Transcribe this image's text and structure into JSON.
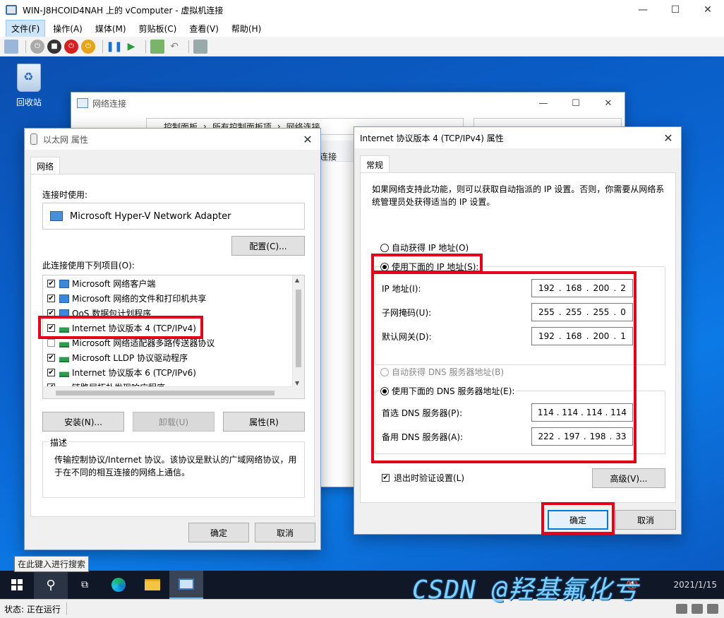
{
  "host": {
    "title": "WIN-J8HCOID4NAH 上的 vComputer - 虚拟机连接",
    "menu": [
      "文件(F)",
      "操作(A)",
      "媒体(M)",
      "剪贴板(C)",
      "查看(V)",
      "帮助(H)"
    ],
    "status": "状态: 正在运行"
  },
  "desktop": {
    "recycle_bin": "回收站"
  },
  "network_window": {
    "title": "网络连接",
    "breadcrumb": [
      "控制面板",
      "所有控制面板项",
      "网络连接"
    ],
    "partial_text": "连接"
  },
  "ethernet_dialog": {
    "title": "以太网 属性",
    "tab": "网络",
    "connect_using_label": "连接时使用:",
    "adapter": "Microsoft Hyper-V Network Adapter",
    "configure_button": "配置(C)...",
    "items_label": "此连接使用下列项目(O):",
    "items": [
      {
        "label": "Microsoft 网络客户端",
        "checked": true,
        "icon": "network-icon"
      },
      {
        "label": "Microsoft 网络的文件和打印机共享",
        "checked": true,
        "icon": "network-icon"
      },
      {
        "label": "QoS 数据包计划程序",
        "checked": true,
        "icon": "network-icon"
      },
      {
        "label": "Internet 协议版本 4 (TCP/IPv4)",
        "checked": true,
        "icon": "protocol-icon"
      },
      {
        "label": "Microsoft 网络适配器多路传送器协议",
        "checked": false,
        "icon": "protocol-icon"
      },
      {
        "label": "Microsoft LLDP 协议驱动程序",
        "checked": true,
        "icon": "protocol-icon"
      },
      {
        "label": "Internet 协议版本 6 (TCP/IPv6)",
        "checked": true,
        "icon": "protocol-icon"
      },
      {
        "label": "链路层拓扑发现响应程序",
        "checked": true,
        "icon": "protocol-icon"
      }
    ],
    "install_button": "安装(N)...",
    "uninstall_button": "卸载(U)",
    "properties_button": "属性(R)",
    "description_legend": "描述",
    "description_text": "传输控制协议/Internet 协议。该协议是默认的广域网络协议，用于在不同的相互连接的网络上通信。",
    "ok_button": "确定",
    "cancel_button": "取消"
  },
  "ipv4_dialog": {
    "title": "Internet 协议版本 4 (TCP/IPv4) 属性",
    "tab": "常规",
    "intro": "如果网络支持此功能，则可以获取自动指派的 IP 设置。否则，你需要从网络系统管理员处获得适当的 IP 设置。",
    "auto_ip": "自动获得 IP 地址(O)",
    "manual_ip": "使用下面的 IP 地址(S):",
    "ip_label": "IP 地址(I):",
    "ip": [
      "192",
      "168",
      "200",
      "2"
    ],
    "mask_label": "子网掩码(U):",
    "mask": [
      "255",
      "255",
      "255",
      "0"
    ],
    "gateway_label": "默认网关(D):",
    "gateway": [
      "192",
      "168",
      "200",
      "1"
    ],
    "auto_dns": "自动获得 DNS 服务器地址(B)",
    "manual_dns": "使用下面的 DNS 服务器地址(E):",
    "dns1_label": "首选 DNS 服务器(P):",
    "dns1": [
      "114",
      "114",
      "114",
      "114"
    ],
    "dns2_label": "备用 DNS 服务器(A):",
    "dns2": [
      "222",
      "197",
      "198",
      "33"
    ],
    "validate_label": "退出时验证设置(L)",
    "advanced_button": "高级(V)...",
    "ok_button": "确定",
    "cancel_button": "取消"
  },
  "taskbar": {
    "search_tooltip": "在此键入进行搜索",
    "clock": "2021/1/15"
  },
  "watermark": "CSDN @羟基氟化亏",
  "colors": {
    "highlight": "#e2001a",
    "desktop": "#0a64d1",
    "taskbar": "#101828"
  }
}
